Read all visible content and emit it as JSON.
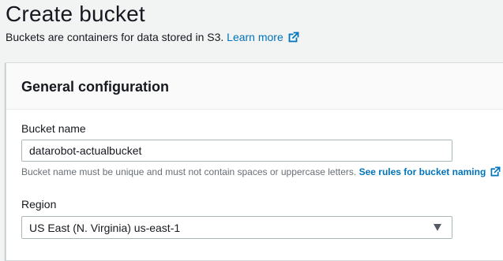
{
  "header": {
    "title": "Create bucket",
    "description": "Buckets are containers for data stored in S3.",
    "learn_more_link": "Learn more"
  },
  "panel": {
    "title": "General configuration",
    "bucket_name": {
      "label": "Bucket name",
      "value": "datarobot-actualbucket",
      "hint": "Bucket name must be unique and must not contain spaces or uppercase letters.",
      "rules_link": "See rules for bucket naming"
    },
    "region": {
      "label": "Region",
      "selected": "US East (N. Virginia) us-east-1"
    }
  },
  "colors": {
    "link": "#0073bb",
    "page_bg": "#f2f3f3",
    "panel_header_bg": "#fafafa",
    "hint_text": "#687078"
  },
  "icons": [
    "external-link-icon",
    "external-link-icon",
    "chevron-down-icon"
  ]
}
